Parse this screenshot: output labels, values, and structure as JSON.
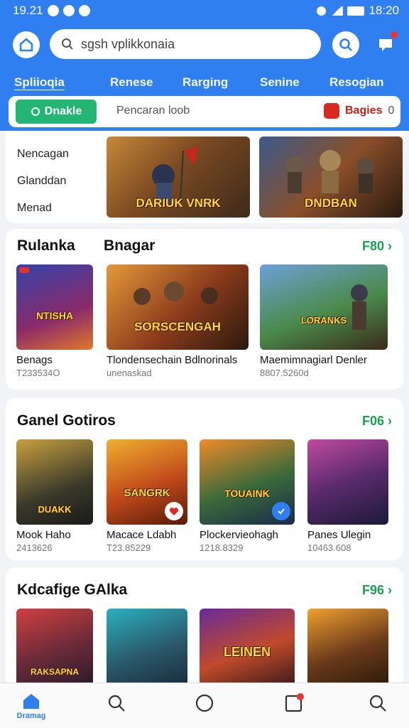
{
  "status_bar": {
    "time_left": "19.21",
    "time_right": "18:20"
  },
  "header": {
    "search_placeholder": "sgsh vplikkonaia",
    "tabs": [
      "Spliioqia",
      "Renese",
      "Rarging",
      "Senine",
      "Resogian"
    ],
    "filter": {
      "enable_label": "Dnakle",
      "text": "Pencaran loob",
      "badge_label": "Bagies",
      "badge_count": "0"
    }
  },
  "featured": {
    "side_links": [
      "Nencagan",
      "Glanddan",
      "Menad"
    ],
    "banners": [
      {
        "caption": "DARIUK VNRK",
        "icon": "knight-banner-image"
      },
      {
        "caption": "DNDBAN",
        "icon": "warrior-group-image"
      }
    ]
  },
  "sections": [
    {
      "title": "Rulanka",
      "title2": "Bnagar",
      "see_all": "F80",
      "cards": [
        {
          "title": "Benags",
          "sub": "T233534O",
          "caption": "NTISHA"
        },
        {
          "title": "Tlondensechain Bdlnorinals",
          "sub": "unenaskad",
          "caption": "SORSCENGAH"
        },
        {
          "title": "Maemimnagiarl Denler",
          "sub": "8807.5260d",
          "caption": "LORANKS"
        }
      ]
    },
    {
      "title": "Ganel Gotiros",
      "see_all": "F06",
      "cards": [
        {
          "title": "Mook Haho",
          "sub": "2413626",
          "caption": "DUAKK"
        },
        {
          "title": "Macace Ldabh",
          "sub": "T23.85229",
          "caption": "SANGRK"
        },
        {
          "title": "Plockervieohagh",
          "sub": "1218.8329",
          "caption": "TOUAINK"
        },
        {
          "title": "Panes Ulegin",
          "sub": "10463.608",
          "caption": ""
        }
      ]
    },
    {
      "title": "Kdcafige GAlka",
      "see_all": "F96",
      "cards": [
        {
          "caption": "RAKSAPNA"
        },
        {
          "caption": ""
        },
        {
          "caption": "LEINEN"
        },
        {
          "caption": ""
        }
      ]
    }
  ],
  "bottom_nav": {
    "home_label": "Dramag"
  },
  "colors": {
    "primary": "#2f7ff0",
    "green": "#22b573",
    "red": "#d72a23"
  }
}
